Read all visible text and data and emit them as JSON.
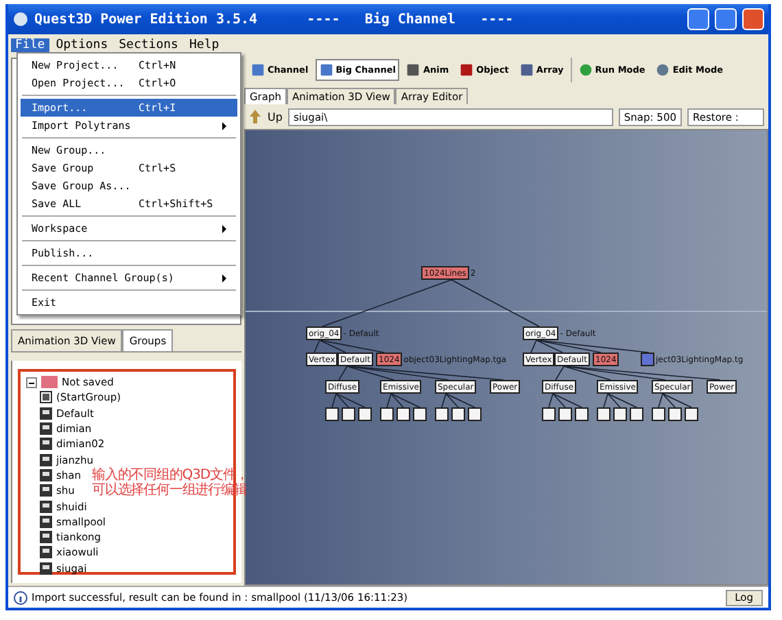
{
  "window": {
    "title": "Quest3D Power Edition 3.5.4      ----   Big Channel   ----"
  },
  "menu_bar": [
    {
      "label": "File",
      "selected": true
    },
    {
      "label": "Options",
      "selected": false
    },
    {
      "label": "Sections",
      "selected": false
    },
    {
      "label": "Help",
      "selected": false
    }
  ],
  "file_menu": [
    {
      "label": "New Project...",
      "shortcut": "Ctrl+N",
      "selected": false
    },
    {
      "label": "Open Project...",
      "shortcut": "Ctrl+O",
      "selected": false
    },
    {
      "kind": "separator"
    },
    {
      "label": "Import...",
      "shortcut": "Ctrl+I",
      "selected": true
    },
    {
      "label": "Import Polytrans",
      "submenu": true,
      "selected": false
    },
    {
      "kind": "separator"
    },
    {
      "label": "New Group...",
      "selected": false
    },
    {
      "label": "Save Group",
      "shortcut": "Ctrl+S",
      "selected": false
    },
    {
      "label": "Save Group As...",
      "selected": false
    },
    {
      "label": "Save ALL",
      "shortcut": "Ctrl+Shift+S",
      "selected": false
    },
    {
      "kind": "separator"
    },
    {
      "label": "Workspace",
      "submenu": true,
      "selected": false
    },
    {
      "kind": "separator"
    },
    {
      "label": "Publish...",
      "selected": false
    },
    {
      "kind": "separator"
    },
    {
      "label": "Recent Channel Group(s)",
      "submenu": true,
      "selected": false
    },
    {
      "kind": "separator"
    },
    {
      "label": "Exit",
      "selected": false
    }
  ],
  "toolbar": [
    {
      "label": "Channel"
    },
    {
      "label": "Big Channel"
    },
    {
      "label": "Anim"
    },
    {
      "label": "Object"
    },
    {
      "label": "Array"
    },
    {
      "kind": "separator"
    },
    {
      "label": "Run Mode"
    },
    {
      "label": "Edit Mode"
    }
  ],
  "view_tabs": [
    {
      "label": "Graph",
      "selected": true
    },
    {
      "label": "Animation 3D View",
      "selected": false
    },
    {
      "label": "Array Editor",
      "selected": false
    }
  ],
  "address_bar": {
    "up_label": "Up",
    "path": "siugai\\",
    "snap": "Snap: 500",
    "restore": "Restore :"
  },
  "graph": {
    "root": {
      "label": "1024Lines",
      "caption": "2"
    },
    "branches": [
      {
        "label": "orig_04",
        "caption": "- Default",
        "row": [
          {
            "label": "Vertex",
            "color": "#f4f4f4"
          },
          {
            "label": "Default",
            "color": "#f4f4f4"
          },
          {
            "label": "1024",
            "color": "#e07070",
            "caption": "object03LightingMap.tga"
          }
        ],
        "channels": [
          {
            "label": "Diffuse",
            "kind": "color"
          },
          {
            "label": "Emissive",
            "kind": "color"
          },
          {
            "label": "Specular",
            "kind": "color"
          },
          {
            "label": "Power",
            "kind": "scalar"
          }
        ]
      },
      {
        "label": "orig_04",
        "caption": "- Default",
        "row": [
          {
            "label": "Vertex",
            "color": "#f4f4f4"
          },
          {
            "label": "Default",
            "color": "#f4f4f4"
          },
          {
            "label": "1024",
            "color": "#e07070"
          },
          {
            "color": "#6070d0",
            "caption": "ject03LightingMap.tg"
          }
        ],
        "channels": [
          {
            "label": "Diffuse",
            "kind": "color"
          },
          {
            "label": "Emissive",
            "kind": "color"
          },
          {
            "label": "Specular",
            "kind": "color"
          },
          {
            "label": "Power",
            "kind": "scalar"
          }
        ]
      }
    ]
  },
  "panel_tabs": [
    {
      "label": "Animation 3D View",
      "selected": false
    },
    {
      "label": "Groups",
      "selected": true
    }
  ],
  "groups_tree": {
    "label": "Not saved",
    "expanded": true,
    "children": [
      {
        "label": "(StartGroup)",
        "kind": "start"
      },
      {
        "label": "Default",
        "kind": "group"
      },
      {
        "label": "dimian",
        "kind": "group"
      },
      {
        "label": "dimian02",
        "kind": "group"
      },
      {
        "label": "jianzhu",
        "kind": "group"
      },
      {
        "label": "shan",
        "kind": "group"
      },
      {
        "label": "shu",
        "kind": "group"
      },
      {
        "label": "shuidi",
        "kind": "group"
      },
      {
        "label": "smallpool",
        "kind": "group"
      },
      {
        "label": "tiankong",
        "kind": "group"
      },
      {
        "label": "xiaowuli",
        "kind": "group"
      },
      {
        "label": "siugai",
        "kind": "group"
      }
    ]
  },
  "annotation": [
    "输入的不同组的Q3D文件，",
    "可以选择任何一组进行编辑"
  ],
  "status_bar": {
    "message": "Import successful, result can be found in : smallpool (11/13/06 16:11:23)",
    "log_button": "Log"
  }
}
